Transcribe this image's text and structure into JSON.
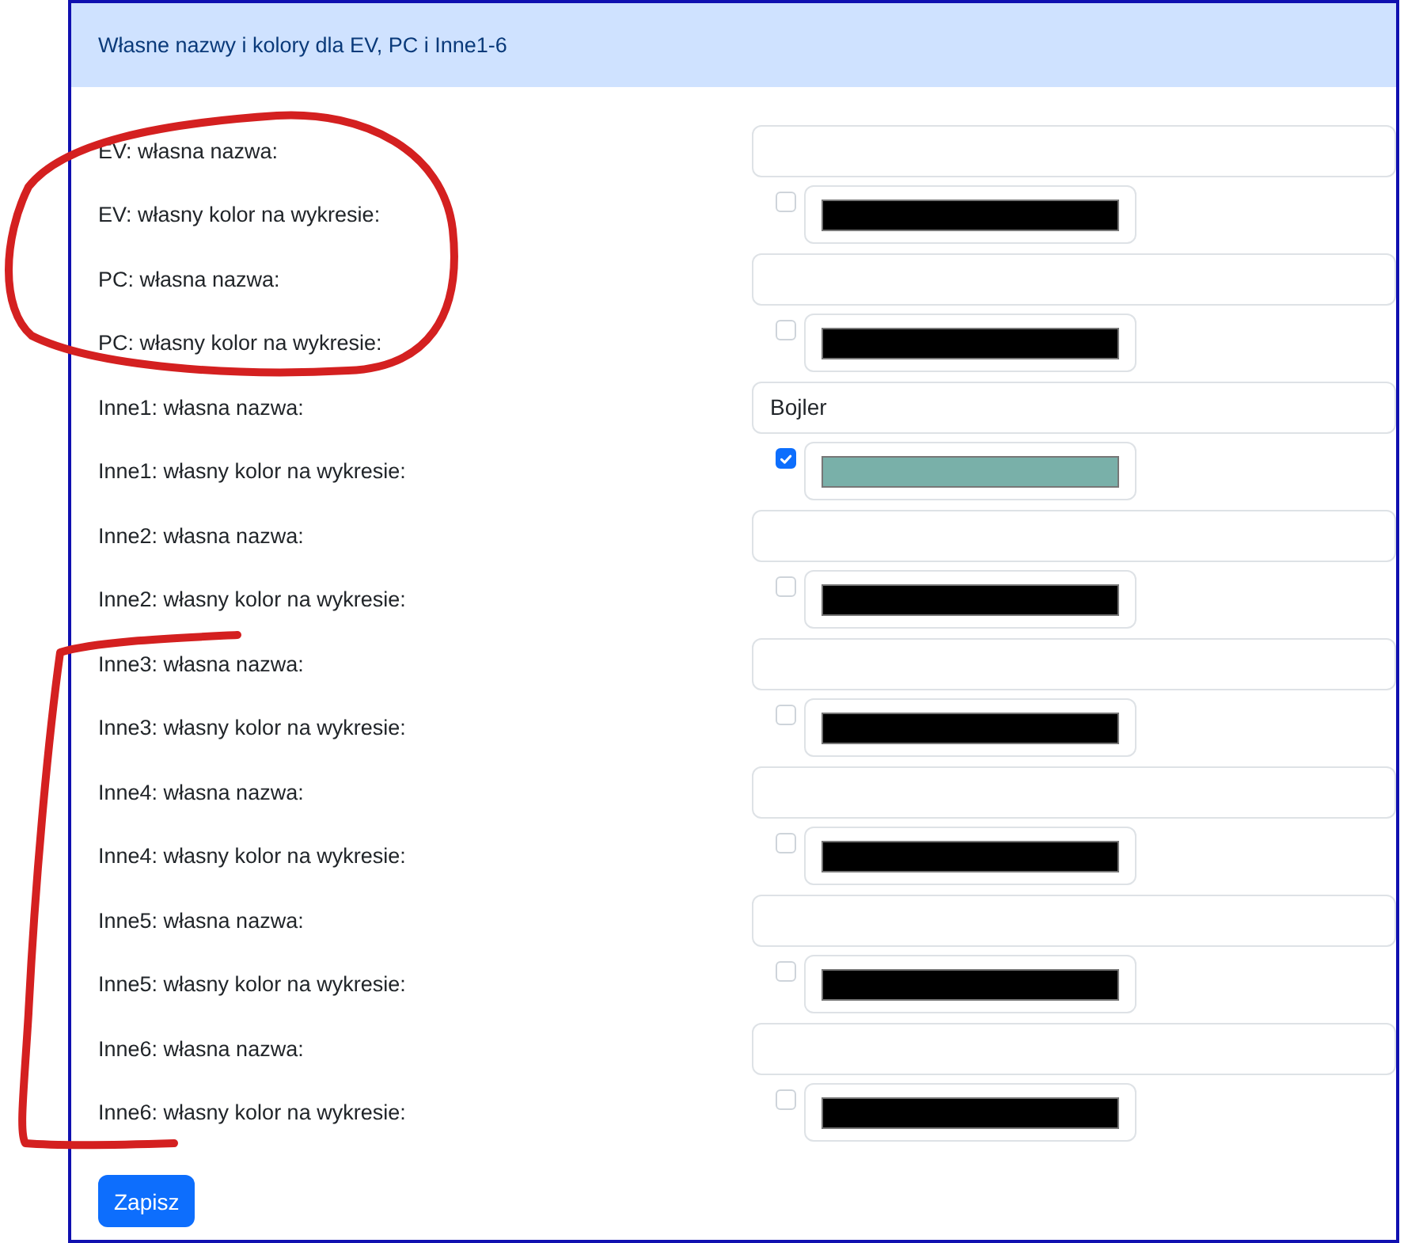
{
  "header": {
    "title": "Własne nazwy i kolory dla EV, PC i Inne1-6"
  },
  "rows": [
    {
      "kind": "name",
      "label": "EV: własna nazwa:",
      "value": ""
    },
    {
      "kind": "color",
      "label": "EV: własny kolor na wykresie:",
      "checked": false,
      "color": "#000000"
    },
    {
      "kind": "name",
      "label": "PC: własna nazwa:",
      "value": ""
    },
    {
      "kind": "color",
      "label": "PC: własny kolor na wykresie:",
      "checked": false,
      "color": "#000000"
    },
    {
      "kind": "name",
      "label": "Inne1: własna nazwa:",
      "value": "Bojler"
    },
    {
      "kind": "color",
      "label": "Inne1: własny kolor na wykresie:",
      "checked": true,
      "color": "#79b0a9"
    },
    {
      "kind": "name",
      "label": "Inne2: własna nazwa:",
      "value": ""
    },
    {
      "kind": "color",
      "label": "Inne2: własny kolor na wykresie:",
      "checked": false,
      "color": "#000000"
    },
    {
      "kind": "name",
      "label": "Inne3: własna nazwa:",
      "value": ""
    },
    {
      "kind": "color",
      "label": "Inne3: własny kolor na wykresie:",
      "checked": false,
      "color": "#000000"
    },
    {
      "kind": "name",
      "label": "Inne4: własna nazwa:",
      "value": ""
    },
    {
      "kind": "color",
      "label": "Inne4: własny kolor na wykresie:",
      "checked": false,
      "color": "#000000"
    },
    {
      "kind": "name",
      "label": "Inne5: własna nazwa:",
      "value": ""
    },
    {
      "kind": "color",
      "label": "Inne5: własny kolor na wykresie:",
      "checked": false,
      "color": "#000000"
    },
    {
      "kind": "name",
      "label": "Inne6: własna nazwa:",
      "value": ""
    },
    {
      "kind": "color",
      "label": "Inne6: własny kolor na wykresie:",
      "checked": false,
      "color": "#000000"
    }
  ],
  "save_button": {
    "label": "Zapisz"
  }
}
